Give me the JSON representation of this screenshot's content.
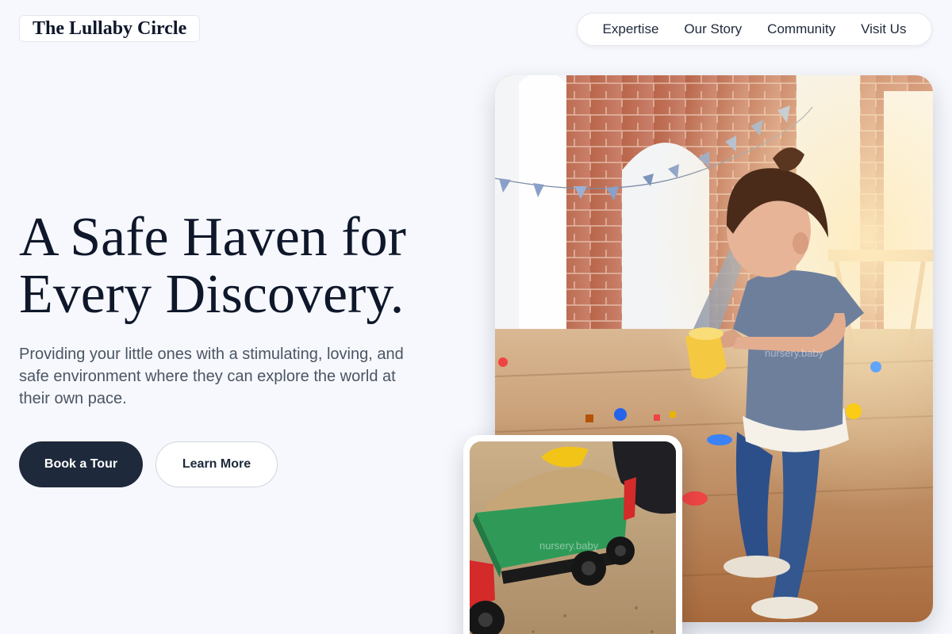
{
  "header": {
    "logo_text": "The Lullaby Circle",
    "nav": [
      {
        "label": "Expertise"
      },
      {
        "label": "Our Story"
      },
      {
        "label": "Community"
      },
      {
        "label": "Visit Us"
      }
    ]
  },
  "hero": {
    "title_line1": "A Safe Haven for",
    "title_line2": "Every Discovery.",
    "subtitle": "Providing your little ones with a stimulating, loving, and safe environment where they can explore the world at their own pace.",
    "primary_button": "Book a Tour",
    "secondary_button": "Learn More"
  },
  "images": {
    "main_watermark": "nursery.baby",
    "sub_watermark": "nursery.baby"
  },
  "colors": {
    "background": "#f6f8fd",
    "primary_button": "#1e293b",
    "text_dark": "#0f172a",
    "text_muted": "#4b5563"
  }
}
